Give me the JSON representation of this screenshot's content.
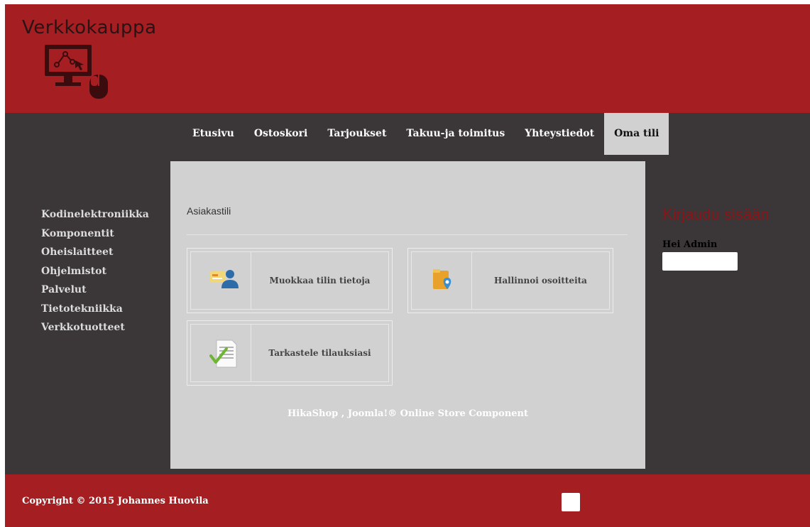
{
  "header": {
    "site_title": "Verkkokauppa"
  },
  "nav": {
    "items": [
      {
        "label": "Etusivu"
      },
      {
        "label": "Ostoskori"
      },
      {
        "label": "Tarjoukset"
      },
      {
        "label": "Takuu-ja toimitus"
      },
      {
        "label": "Yhteystiedot"
      },
      {
        "label": "Oma tili",
        "active": true
      }
    ]
  },
  "sidebar": {
    "items": [
      {
        "label": "Kodinelektroniikka"
      },
      {
        "label": "Komponentit"
      },
      {
        "label": "Oheislaitteet"
      },
      {
        "label": "Ohjelmistot"
      },
      {
        "label": "Palvelut"
      },
      {
        "label": "Tietotekniikka"
      },
      {
        "label": "Verkkotuotteet"
      }
    ]
  },
  "main": {
    "title": "Asiakastili",
    "cards": [
      {
        "label": "Muokkaa tilin tietoja",
        "icon": "user-card-icon"
      },
      {
        "label": "Hallinnoi osoitteita",
        "icon": "address-folder-icon"
      },
      {
        "label": "Tarkastele tilauksiasi",
        "icon": "order-document-icon"
      }
    ],
    "powered_by": "HikaShop , Joomla!® Online Store Component"
  },
  "login": {
    "title": "Kirjaudu sisään",
    "greeting": "Hei Admin"
  },
  "footer": {
    "copyright": "Copyright © 2015 Johannes Huovila"
  },
  "colors": {
    "brand_red": "#a51e22",
    "dark_bg": "#3b3637",
    "panel_gray": "#d1d1d1",
    "login_title": "#8a1619"
  }
}
